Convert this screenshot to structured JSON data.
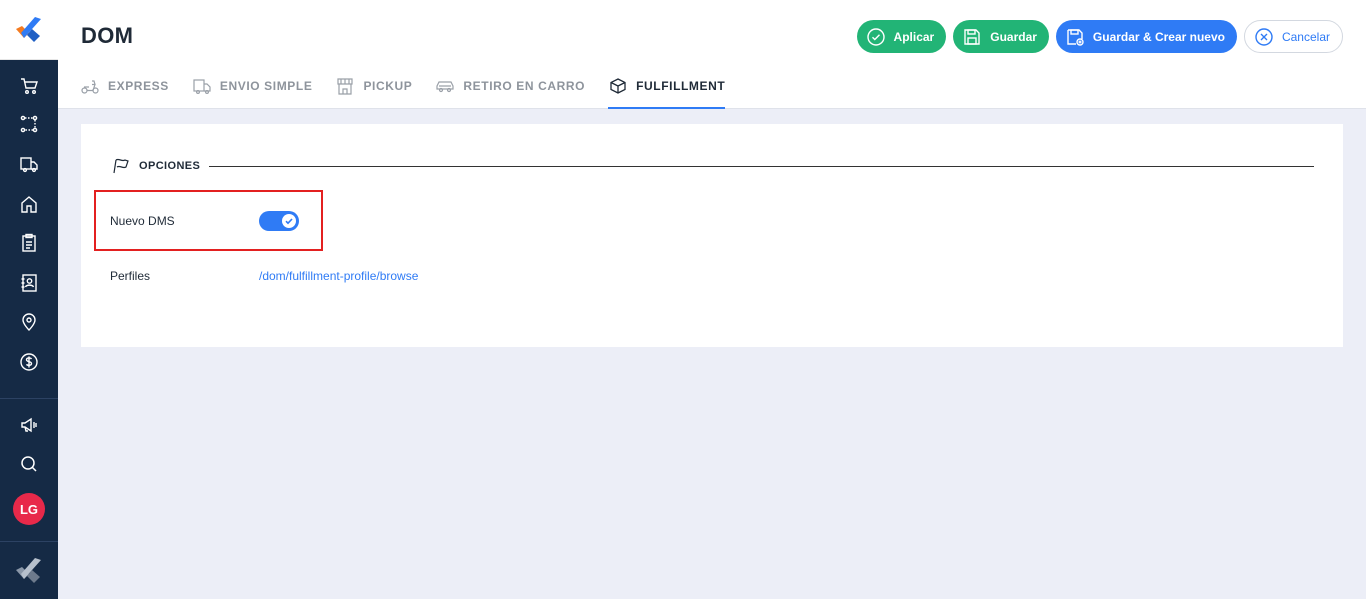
{
  "app": {
    "title": "DOM",
    "colors": {
      "primary": "#2f7bf5",
      "success": "#22b476",
      "sidebar": "#152a45",
      "avatar": "#e8294a",
      "highlight": "#e32020"
    }
  },
  "sidebar": {
    "items": [
      {
        "name": "cart",
        "icon": "cart-icon"
      },
      {
        "name": "routes",
        "icon": "route-icon"
      },
      {
        "name": "delivery",
        "icon": "truck-icon"
      },
      {
        "name": "home",
        "icon": "home-icon"
      },
      {
        "name": "orders",
        "icon": "clipboard-icon"
      },
      {
        "name": "contacts",
        "icon": "contact-book-icon"
      },
      {
        "name": "locations",
        "icon": "map-pin-icon"
      },
      {
        "name": "billing",
        "icon": "dollar-icon"
      },
      {
        "name": "announcements",
        "icon": "megaphone-icon"
      },
      {
        "name": "search",
        "icon": "search-icon"
      }
    ],
    "avatar": "LG"
  },
  "header": {
    "actions": {
      "apply": "Aplicar",
      "save": "Guardar",
      "save_new": "Guardar & Crear nuevo",
      "cancel": "Cancelar"
    },
    "tabs": [
      {
        "label": "EXPRESS",
        "icon": "scooter-icon",
        "active": false
      },
      {
        "label": "ENVIO SIMPLE",
        "icon": "truck-icon",
        "active": false
      },
      {
        "label": "PICKUP",
        "icon": "store-icon",
        "active": false
      },
      {
        "label": "RETIRO EN CARRO",
        "icon": "car-icon",
        "active": false
      },
      {
        "label": "FULFILLMENT",
        "icon": "box-icon",
        "active": true
      }
    ]
  },
  "section": {
    "title": "OPCIONES",
    "icon": "flag-icon",
    "nuevo_dms": {
      "label": "Nuevo DMS",
      "enabled": true
    },
    "perfiles": {
      "label": "Perfiles",
      "link": "/dom/fulfillment-profile/browse"
    }
  }
}
